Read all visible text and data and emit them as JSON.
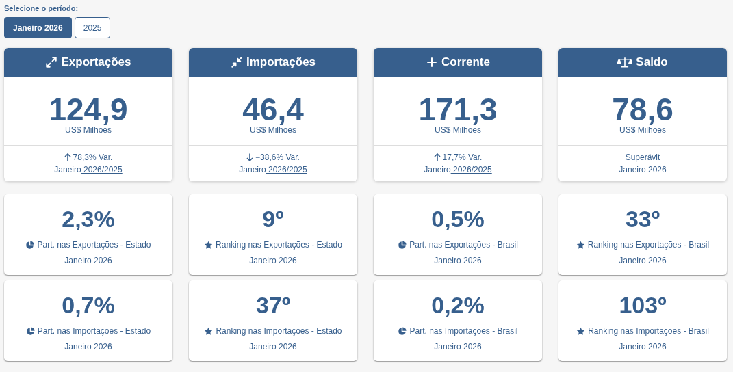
{
  "period_selector": {
    "label": "Selecione o período:",
    "options": [
      {
        "label": "Janeiro 2026",
        "selected": true
      },
      {
        "label": "2025",
        "selected": false
      }
    ]
  },
  "summary_cards": [
    {
      "kind": "exports",
      "title": "Exportações",
      "value": "124,9",
      "unit": "US$ Milhões",
      "footer": {
        "kind": "increase",
        "text": "78,3% Var.",
        "period": "Janeiro",
        "period_link": " 2026/2025"
      }
    },
    {
      "kind": "imports",
      "title": "Importações",
      "value": "46,4",
      "unit": "US$ Milhões",
      "footer": {
        "kind": "decrease",
        "text": "−38,6% Var.",
        "period": "Janeiro",
        "period_link": " 2026/2025"
      }
    },
    {
      "kind": "total",
      "title": "Corrente",
      "value": "171,3",
      "unit": "US$ Milhões",
      "footer": {
        "kind": "increase",
        "text": "17,7% Var.",
        "period": "Janeiro",
        "period_link": " 2026/2025"
      }
    },
    {
      "kind": "balance",
      "title": "Saldo",
      "value": "78,6",
      "unit": "US$ Milhões",
      "footer": {
        "kind": "note",
        "text": "Superávit",
        "period": "Janeiro 2026"
      }
    }
  ],
  "stat_cards": [
    {
      "kind": "share",
      "value": "2,3%",
      "label": "Part. nas Exportações - Estado",
      "period": "Janeiro 2026"
    },
    {
      "kind": "ranking",
      "value": "9º",
      "label": "Ranking nas Exportações - Estado",
      "period": "Janeiro 2026"
    },
    {
      "kind": "share",
      "value": "0,5%",
      "label": "Part. nas Exportações - Brasil",
      "period": "Janeiro 2026"
    },
    {
      "kind": "ranking",
      "value": "33º",
      "label": "Ranking nas Exportações - Brasil",
      "period": "Janeiro 2026"
    },
    {
      "kind": "share",
      "value": "0,7%",
      "label": "Part. nas Importações - Estado",
      "period": "Janeiro 2026"
    },
    {
      "kind": "ranking",
      "value": "37º",
      "label": "Ranking nas Importações - Estado",
      "period": "Janeiro 2026"
    },
    {
      "kind": "share",
      "value": "0,2%",
      "label": "Part. nas Importações - Brasil",
      "period": "Janeiro 2026"
    },
    {
      "kind": "ranking",
      "value": "103º",
      "label": "Ranking nas Importações - Brasil",
      "period": "Janeiro 2026"
    }
  ]
}
